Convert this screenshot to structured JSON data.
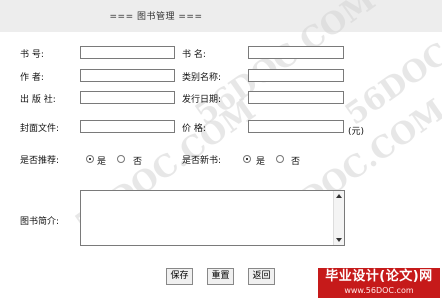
{
  "header": {
    "title": "=== 图书管理 ==="
  },
  "form": {
    "book_no_label": "书 号:",
    "book_name_label": "书 名:",
    "author_label": "作 者:",
    "category_label": "类别名称:",
    "publisher_label": "出 版 社:",
    "publish_date_label": "发行日期:",
    "cover_label": "封面文件:",
    "price_label": "价 格:",
    "price_unit": "(元)",
    "recommend_label": "是否推荐:",
    "new_book_label": "是否新书:",
    "yes": "是",
    "no": "否",
    "intro_label": "图书简介:"
  },
  "buttons": {
    "save": "保存",
    "reset": "重置",
    "back": "返回"
  },
  "watermark": {
    "text": "56DOC.COM"
  },
  "brand": {
    "title": "毕业设计(论文)网",
    "url": "www.56DOC.com"
  }
}
